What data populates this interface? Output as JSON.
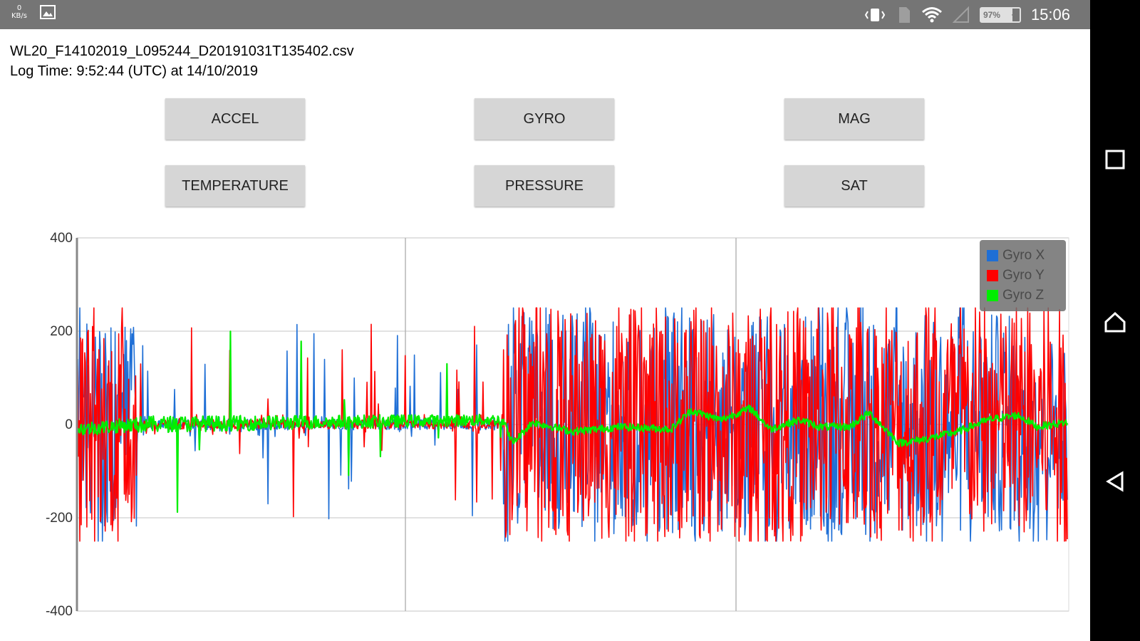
{
  "statusbar": {
    "net_speed_value": "0",
    "net_speed_unit": "KB/s",
    "battery": "97%",
    "time": "15:06"
  },
  "file": {
    "name": "WL20_F14102019_L095244_D20191031T135402.csv",
    "log_time": "Log Time: 9:52:44 (UTC) at 14/10/2019"
  },
  "buttons": {
    "accel": "ACCEL",
    "gyro": "GYRO",
    "mag": "MAG",
    "temperature": "TEMPERATURE",
    "pressure": "PRESSURE",
    "sat": "SAT"
  },
  "colors": {
    "gyro_x": "#1f6fd6",
    "gyro_y": "#ff0000",
    "gyro_z": "#00ee00",
    "grid": "#d9d9d9",
    "axis": "#888888"
  },
  "chart_data": {
    "type": "line",
    "ylim": [
      -400,
      400
    ],
    "yticks": [
      400,
      200,
      0,
      -200,
      -400
    ],
    "clip": [
      -250,
      250
    ],
    "segment_breaks": [
      0.06,
      0.43
    ],
    "legend_position": "top-right",
    "series": [
      {
        "name": "Gyro X",
        "color": "#1f6fd6",
        "profile": [
          [
            0.0,
            220
          ],
          [
            0.06,
            220
          ],
          [
            0.061,
            12
          ],
          [
            0.43,
            12
          ],
          [
            0.431,
            240
          ],
          [
            0.95,
            240
          ],
          [
            1.0,
            170
          ]
        ]
      },
      {
        "name": "Gyro Y",
        "color": "#ff0000",
        "profile": [
          [
            0.0,
            230
          ],
          [
            0.06,
            230
          ],
          [
            0.061,
            10
          ],
          [
            0.43,
            10
          ],
          [
            0.431,
            250
          ],
          [
            1.0,
            250
          ]
        ]
      },
      {
        "name": "Gyro Z",
        "color": "#00ee00",
        "profile": [
          [
            0.0,
            15
          ],
          [
            0.06,
            15
          ],
          [
            0.061,
            18
          ],
          [
            0.43,
            12
          ],
          [
            0.431,
            8
          ],
          [
            1.0,
            8
          ]
        ],
        "baseline": [
          [
            0.0,
            -10
          ],
          [
            0.06,
            0
          ],
          [
            0.43,
            10
          ],
          [
            0.44,
            -40
          ],
          [
            0.46,
            5
          ],
          [
            0.5,
            -15
          ],
          [
            0.55,
            -5
          ],
          [
            0.6,
            -10
          ],
          [
            0.62,
            30
          ],
          [
            0.65,
            10
          ],
          [
            0.68,
            35
          ],
          [
            0.7,
            -10
          ],
          [
            0.73,
            10
          ],
          [
            0.75,
            -5
          ],
          [
            0.78,
            -5
          ],
          [
            0.8,
            25
          ],
          [
            0.83,
            -40
          ],
          [
            0.86,
            -30
          ],
          [
            0.89,
            -15
          ],
          [
            0.92,
            10
          ],
          [
            0.95,
            20
          ],
          [
            0.97,
            -5
          ],
          [
            1.0,
            5
          ]
        ]
      }
    ]
  }
}
